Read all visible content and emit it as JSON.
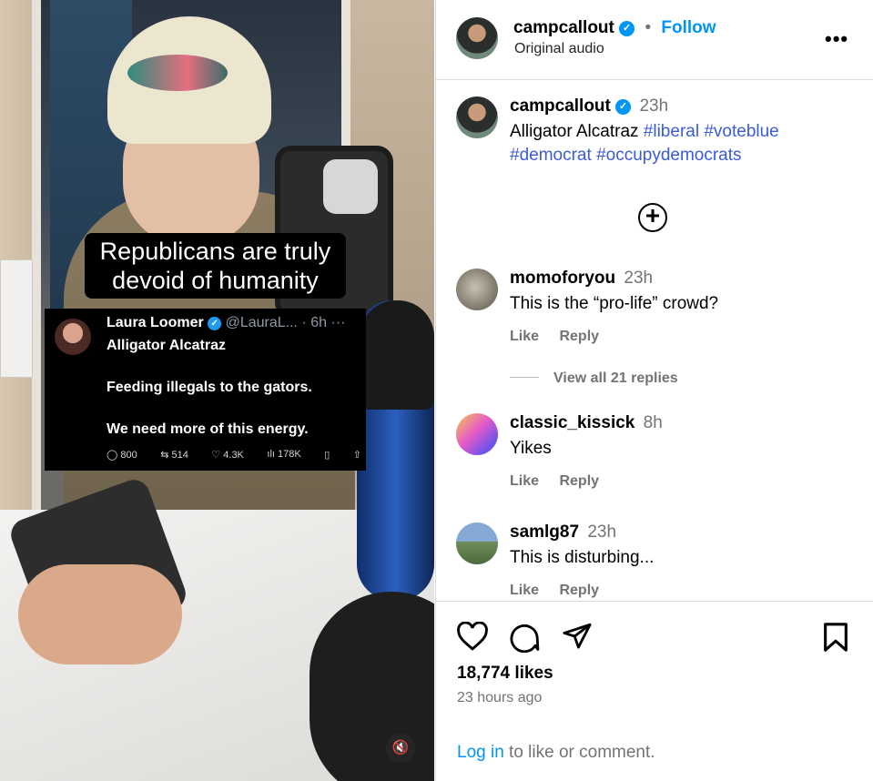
{
  "video": {
    "caption_line1": "Republicans are truly",
    "caption_line2": "devoid of humanity",
    "tweet": {
      "name": "Laura Loomer",
      "verified_icon": "✓",
      "handle": "@LauraL...",
      "time": "· 6h",
      "more": "···",
      "line1": "Alligator Alcatraz",
      "line2": "Feeding illegals to the gators.",
      "line3": "We need more of this energy.",
      "replies": "800",
      "retweets": "514",
      "likes": "4.3K",
      "views": "178K"
    },
    "mute_icon": "🔇"
  },
  "header": {
    "username": "campcallout",
    "verified_icon": "✓",
    "separator": "•",
    "follow_label": "Follow",
    "subtitle": "Original audio",
    "more_label": "•••"
  },
  "caption": {
    "username": "campcallout",
    "time": "23h",
    "text": "Alligator Alcatraz",
    "hashtags": [
      "#liberal",
      "#voteblue",
      "#democrat",
      "#occupydemocrats"
    ]
  },
  "comments": [
    {
      "username": "momoforyou",
      "time": "23h",
      "text": "This is the “pro-life” crowd?",
      "like": "Like",
      "reply": "Reply"
    },
    {
      "username": "classic_kissick",
      "time": "8h",
      "text": "Yikes",
      "like": "Like",
      "reply": "Reply"
    },
    {
      "username": "samlg87",
      "time": "23h",
      "text": "This is disturbing...",
      "like": "Like",
      "reply": "Reply"
    }
  ],
  "view_replies": "View all 21 replies",
  "post": {
    "likes": "18,774 likes",
    "time_ago": "23 hours ago",
    "login_link": "Log in",
    "login_rest": " to like or comment."
  },
  "colors": {
    "accent": "#0095f6",
    "hashtag": "#3b5bdb",
    "muted": "#737373",
    "divider": "#dbdbdb"
  }
}
